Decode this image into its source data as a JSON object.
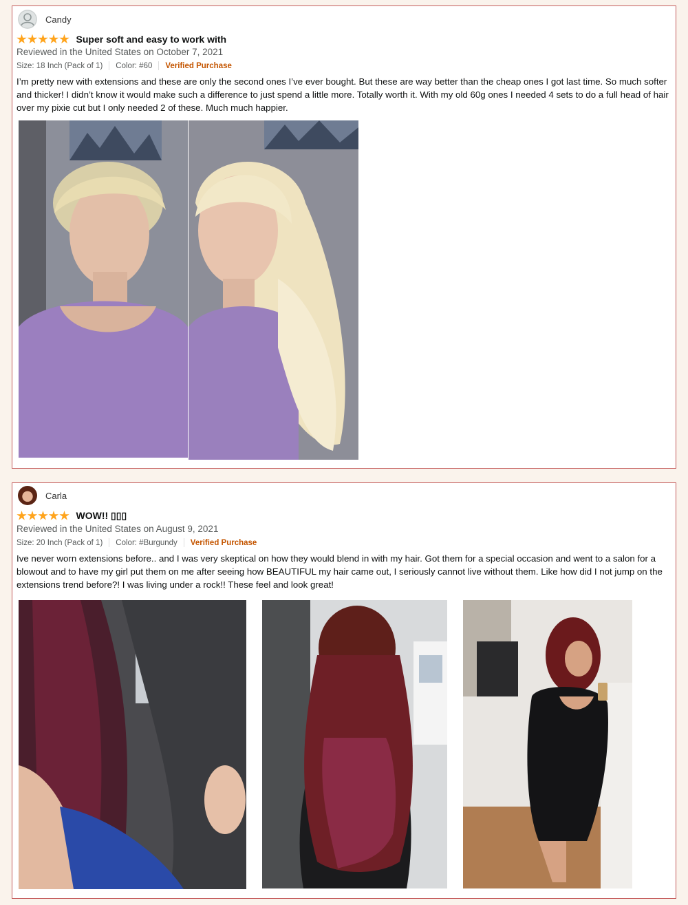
{
  "reviews": [
    {
      "reviewer": "Candy",
      "avatar_type": "default-person-icon",
      "rating": 5,
      "title": "Super soft and easy to work with",
      "date_line": "Reviewed in the United States on October 7, 2021",
      "size": "Size: 18 Inch (Pack of 1)",
      "color": "Color: #60",
      "verified": "Verified Purchase",
      "body": "I’m pretty new with extensions and these are only the second ones I’ve ever bought. But these are way better than the cheap ones I got last time. So much softer and thicker! I didn’t know it would make such a difference to just spend a little more. Totally worth it. With my old 60g ones I needed 4 sets to do a full head of hair over my pixie cut but I only needed 2 of these. Much much happier.",
      "photos": [
        "before-short-blonde-hair-photo",
        "after-long-blonde-extensions-photo"
      ]
    },
    {
      "reviewer": "Carla",
      "avatar_type": "profile-photo",
      "rating": 5,
      "title": "WOW!! ▯▯▯",
      "date_line": "Reviewed in the United States on August 9, 2021",
      "size": "Size: 20 Inch (Pack of 1)",
      "color": "Color: #Burgundy",
      "verified": "Verified Purchase",
      "body": "Ive never worn extensions before.. and I was very skeptical on how they would blend in with my hair. Got them for a special occasion and went to a salon for a blowout and to have my girl put them on me after seeing how BEAUTIFUL my hair came out, I seriously cannot live without them. Like how did I not jump on the extensions trend before?! I was living under a rock!! These feel and look great!",
      "photos": [
        "burgundy-hair-car-selfie-photo",
        "burgundy-hair-back-view-salon-photo",
        "burgundy-hair-mirror-selfie-photo"
      ]
    }
  ],
  "colors": {
    "star": "#ffa41c",
    "verified": "#c45500",
    "card_border": "#c45a5a",
    "page_bg": "#faf3ec"
  }
}
